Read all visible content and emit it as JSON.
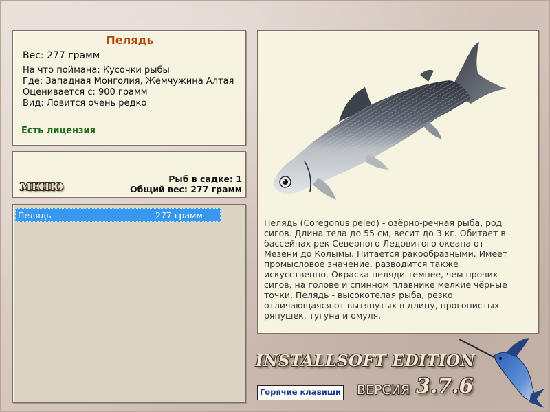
{
  "fish": {
    "name": "Пелядь",
    "weight": "Вес: 277 грамм",
    "bait": "На что поймана: Кусочки рыбы",
    "location": "Где: Западная Монголия, Жемчужина Алтая",
    "valued_from": "Оценивается с: 900 грамм",
    "kind": "Вид: Ловится очень редко",
    "license": "Есть лицензия"
  },
  "menu": {
    "label": "МЕНЮ"
  },
  "keepnet": {
    "count": "Рыб в садке: 1",
    "total_weight": "Общий вес: 277 грамм",
    "items": [
      {
        "name": "Пелядь",
        "weight": "277 грамм"
      }
    ]
  },
  "description": "Пелядь (Coregonus peled) - озёрно-речная рыба, род сигов. Длина тела до 55 см, весит до 3 кг. Обитает в бассейнах рек Северного Ледовитого океана от Мезени до Колымы. Питается ракообразными. Имеет промысловое значение, разводится также искусственно. Окраска пеляди темнее, чем прочих сигов, на голове и спинном плавнике мелкие чёрные точки. Пелядь - высокотелая рыба, резко отличающаяся от вытянутых в длину, прогонистых ряпушек, тугуна и омуля.",
  "footer": {
    "edition": "INSTALLSOFT EDITION",
    "version_label": "ВЕРСИЯ",
    "version": "3.7.6",
    "hotkeys": "Горячие клавиши"
  },
  "colors": {
    "title": "#b5470f",
    "license": "#1f6b1f",
    "selection": "#3898f0",
    "panel": "#f7f3e1"
  },
  "icons": [
    "fish-image",
    "marlin-logo"
  ]
}
